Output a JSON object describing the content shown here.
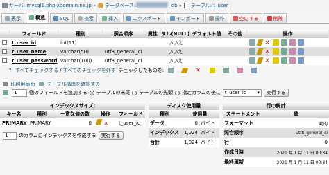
{
  "breadcrumb": {
    "server_label": "サーバ: mysql1.php.xdomain.ne.jp",
    "database_prefix": "データベース:",
    "database_suffix": "_db",
    "table_label": "テーブル: t_user"
  },
  "tabs": [
    {
      "label": "表示",
      "icon": "table-icon"
    },
    {
      "label": "構造",
      "icon": "structure-icon",
      "active": true
    },
    {
      "label": "SQL",
      "icon": "sql-icon"
    },
    {
      "label": "検索",
      "icon": "search-icon"
    },
    {
      "label": "挿入",
      "icon": "insert-icon"
    },
    {
      "label": "エクスポート",
      "icon": "export-icon"
    },
    {
      "label": "インポート",
      "icon": "import-icon"
    },
    {
      "label": "操作",
      "icon": "wrench-icon"
    },
    {
      "label": "空にする",
      "icon": "empty-icon"
    },
    {
      "label": "削除",
      "icon": "delete-icon"
    }
  ],
  "structure": {
    "headers": [
      "フィールド",
      "種別",
      "照合順序",
      "属性",
      "ヌル(NULL)",
      "デフォルト値",
      "その他",
      "操作"
    ],
    "rows": [
      {
        "field": "t_user_id",
        "type": "int(11)",
        "collation": "",
        "attributes": "",
        "null": "いいえ",
        "default": "",
        "extra": ""
      },
      {
        "field": "t_user_name",
        "type": "varchar(50)",
        "collation": "utf8_general_ci",
        "attributes": "",
        "null": "いいえ",
        "default": "",
        "extra": ""
      },
      {
        "field": "t_user_password",
        "type": "varchar(100)",
        "collation": "utf8_general_ci",
        "attributes": "",
        "null": "いいえ",
        "default": "",
        "extra": ""
      }
    ],
    "check_all": "すべてチェックする",
    "uncheck_all": "すべてのチェックを外す",
    "with_selected": "チェックしたものを:"
  },
  "print_view": "印刷用画面",
  "propose_structure": "テーブル構造を確認する",
  "add_fields": {
    "count": "1",
    "label": "個のフィールドを追加する",
    "opt_end": "テーブルの末尾",
    "opt_start": "テーブルの先頭",
    "opt_after": "指定カラムの後に",
    "after_value": "t_user_id",
    "go": "実行する"
  },
  "indexes": {
    "title": "インデックスサイズ:",
    "headers": [
      "キー名",
      "種別",
      "一意な値の数",
      "操作",
      "フィールド"
    ],
    "rows": [
      {
        "key": "PRIMARY",
        "type": "PRIMARY",
        "cardinality": "0",
        "field": "t_user_id"
      }
    ],
    "create_count": "1",
    "create_label": "のカラムにインデックスを作成する",
    "go": "実行する"
  },
  "disk_usage": {
    "title": "ディスク使用量",
    "headers": [
      "種別",
      "使用量"
    ],
    "rows": [
      {
        "type": "データ",
        "value": "0",
        "unit": "バイト"
      },
      {
        "type": "インデックス",
        "value": "1,024",
        "unit": "バイト"
      },
      {
        "type": "合計",
        "value": "1,024",
        "unit": "バイト"
      }
    ]
  },
  "row_stats": {
    "title": "行の統計",
    "headers": [
      "ステートメント",
      "値"
    ],
    "rows": [
      {
        "label": "フォーマット",
        "value": "動的"
      },
      {
        "label": "照合順序",
        "value": "utf8_general_ci"
      },
      {
        "label": "行",
        "value": "0"
      },
      {
        "label": "作成日時",
        "value": "2021 年 1 月 11 日 00:34"
      },
      {
        "label": "最終更新",
        "value": "2021 年 1 月 11 日 00:34"
      }
    ]
  }
}
